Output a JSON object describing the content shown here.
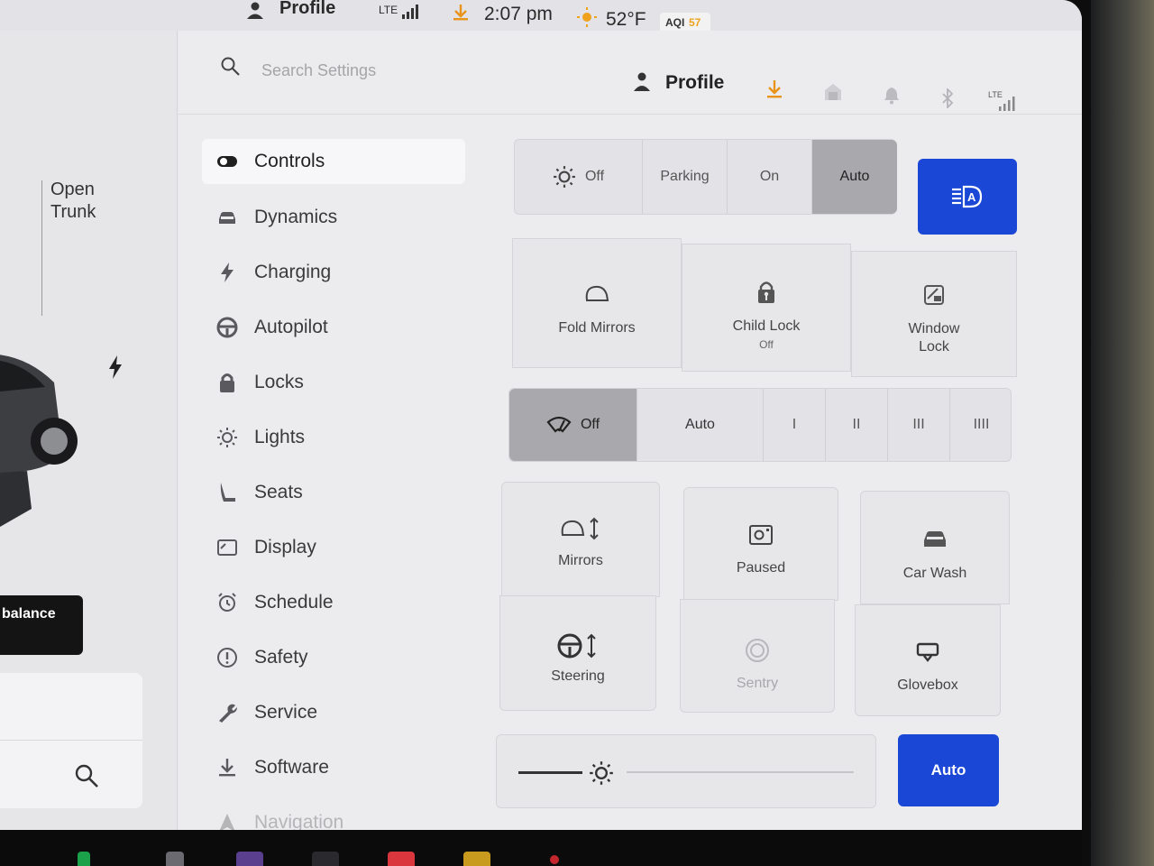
{
  "status_bar": {
    "profile_label": "Profile",
    "network": "LTE",
    "time": "2:07 pm",
    "temperature": "52°F",
    "aqi_label": "AQI",
    "aqi_value": "57"
  },
  "car_pane": {
    "trunk_label_line1": "Open",
    "trunk_label_line2": "Trunk",
    "balance_label": "balance"
  },
  "topbar": {
    "search_placeholder": "Search Settings",
    "profile_label": "Profile",
    "network": "LTE"
  },
  "nav": {
    "items": [
      {
        "label": "Controls",
        "icon": "toggle-icon",
        "active": true
      },
      {
        "label": "Dynamics",
        "icon": "car-icon"
      },
      {
        "label": "Charging",
        "icon": "bolt-icon"
      },
      {
        "label": "Autopilot",
        "icon": "steering-wheel-icon"
      },
      {
        "label": "Locks",
        "icon": "lock-icon"
      },
      {
        "label": "Lights",
        "icon": "sun-icon"
      },
      {
        "label": "Seats",
        "icon": "seat-icon"
      },
      {
        "label": "Display",
        "icon": "display-icon"
      },
      {
        "label": "Schedule",
        "icon": "alarm-clock-icon"
      },
      {
        "label": "Safety",
        "icon": "alert-circle-icon"
      },
      {
        "label": "Service",
        "icon": "wrench-icon"
      },
      {
        "label": "Software",
        "icon": "download-icon"
      },
      {
        "label": "Navigation",
        "icon": "navigation-arrow-icon"
      }
    ]
  },
  "headlights": {
    "options": [
      "Off",
      "Parking",
      "On",
      "Auto"
    ],
    "selected": "Auto",
    "auto_high_beam_icon": "auto-high-beam-icon"
  },
  "quick_tiles_row1": {
    "fold_mirrors": "Fold Mirrors",
    "child_lock": "Child Lock",
    "child_lock_state": "Off",
    "window_lock_line1": "Window",
    "window_lock_line2": "Lock"
  },
  "wipers": {
    "options": [
      "Off",
      "Auto",
      "I",
      "II",
      "III",
      "IIII"
    ],
    "selected": "Off"
  },
  "quick_tiles_row2": {
    "mirrors": "Mirrors",
    "dashcam": "Paused",
    "car_wash": "Car Wash",
    "steering": "Steering",
    "sentry": "Sentry",
    "glovebox": "Glovebox"
  },
  "brightness": {
    "auto_label": "Auto",
    "level_fraction": 0.2
  },
  "colors": {
    "accent_blue": "#1a47d6",
    "selected_gray": "#a9a8ac",
    "download_orange": "#e8931a"
  }
}
